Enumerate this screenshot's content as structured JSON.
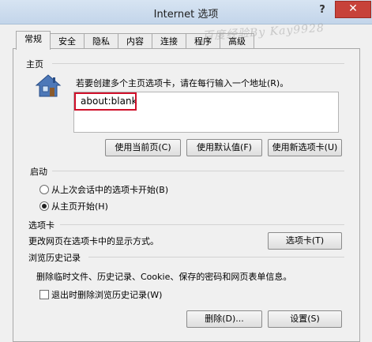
{
  "window": {
    "title": "Internet 选项",
    "help_label": "?",
    "close_label": "✕"
  },
  "tabs": [
    "常规",
    "安全",
    "隐私",
    "内容",
    "连接",
    "程序",
    "高级"
  ],
  "active_tab": "常规",
  "watermark": "百度经验By Kay9928",
  "homepage": {
    "section_label": "主页",
    "instruction": "若要创建多个主页选项卡，请在每行输入一个地址(R)。",
    "value": "about:blank",
    "buttons": [
      "使用当前页(C)",
      "使用默认值(F)",
      "使用新选项卡(U)"
    ]
  },
  "startup": {
    "section_label": "启动",
    "options": [
      "从上次会话中的选项卡开始(B)",
      "从主页开始(H)"
    ],
    "selected_index": 1
  },
  "tabs_section": {
    "section_label": "选项卡",
    "description": "更改网页在选项卡中的显示方式。",
    "button": "选项卡(T)"
  },
  "history": {
    "section_label": "浏览历史记录",
    "description": "删除临时文件、历史记录、Cookie、保存的密码和网页表单信息。",
    "checkbox_label": "退出时删除浏览历史记录(W)",
    "checkbox_checked": false,
    "delete_button": "删除(D)...",
    "settings_button": "设置(S)"
  },
  "colors": {
    "close": "#c7423a",
    "highlight": "#d0102a"
  }
}
